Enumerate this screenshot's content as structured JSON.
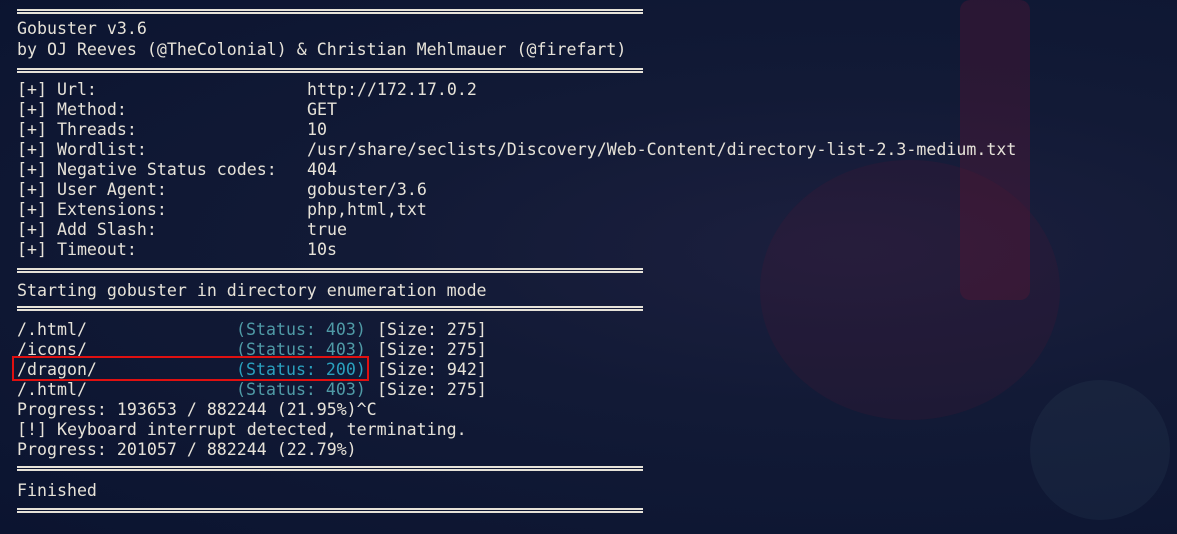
{
  "banner": {
    "title": "Gobuster v3.6",
    "authors": "by OJ Reeves (@TheColonial) & Christian Mehlmauer (@firefart)"
  },
  "config": [
    {
      "label": "[+] Url:",
      "value": "http://172.17.0.2"
    },
    {
      "label": "[+] Method:",
      "value": "GET"
    },
    {
      "label": "[+] Threads:",
      "value": "10"
    },
    {
      "label": "[+] Wordlist:",
      "value": "/usr/share/seclists/Discovery/Web-Content/directory-list-2.3-medium.txt"
    },
    {
      "label": "[+] Negative Status codes:",
      "value": "404"
    },
    {
      "label": "[+] User Agent:",
      "value": "gobuster/3.6"
    },
    {
      "label": "[+] Extensions:",
      "value": "php,html,txt"
    },
    {
      "label": "[+] Add Slash:",
      "value": "true"
    },
    {
      "label": "[+] Timeout:",
      "value": "10s"
    }
  ],
  "start_message": "Starting gobuster in directory enumeration mode",
  "results": [
    {
      "path": "/.html/",
      "status": "(Status: 403)",
      "size": "[Size: 275]"
    },
    {
      "path": "/icons/",
      "status": "(Status: 403)",
      "size": "[Size: 275]"
    },
    {
      "path": "/dragon/",
      "status": "(Status: 200)",
      "size": "[Size: 942]"
    },
    {
      "path": "/.html/",
      "status": "(Status: 403)",
      "size": "[Size: 275]"
    }
  ],
  "output": [
    "Progress: 193653 / 882244 (21.95%)^C",
    "[!] Keyboard interrupt detected, terminating.",
    "Progress: 201057 / 882244 (22.79%)"
  ],
  "finished": "Finished",
  "colors": {
    "status": "#4f9aa6",
    "status_highlight": "#2aa0bd",
    "highlight_box": "#e01010",
    "background": "#0b1430"
  }
}
